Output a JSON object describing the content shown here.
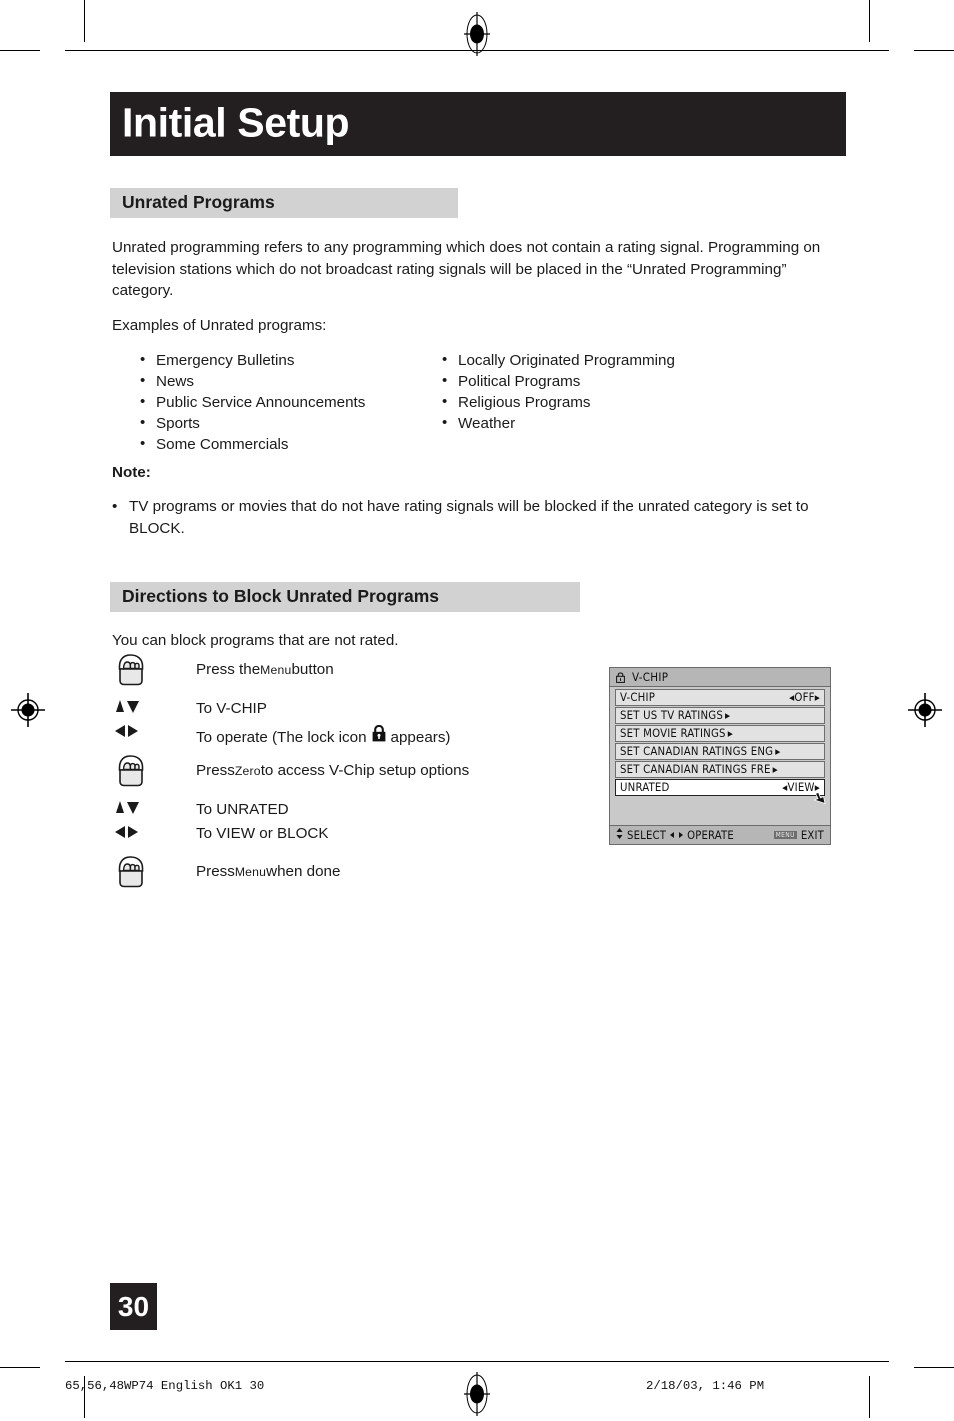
{
  "document": {
    "chapter_title": "Initial Setup",
    "page_number": "30"
  },
  "sections": {
    "unrated": {
      "heading": "Unrated Programs",
      "intro": "Unrated programming refers to any programming which does not contain a rating signal. Programming on television stations which do not broadcast rating signals will be placed in the “Unrated Programming” category.",
      "examples_label": "Examples of Unrated programs:",
      "examples_left": [
        "Emergency Bulletins",
        "News",
        "Public Service Announcements",
        "Sports",
        "Some Commercials"
      ],
      "examples_right": [
        "Locally Originated Programming",
        "Political Programs",
        "Religious Programs",
        "Weather"
      ],
      "note_label": "Note:",
      "note_text": "TV programs or movies that do not have rating signals will be blocked if the unrated category is set to BLOCK."
    },
    "directions": {
      "heading": "Directions to Block Unrated Programs",
      "intro": "You can block programs that are not rated.",
      "steps": [
        {
          "icon": "hand-press-button-icon",
          "text_pre": "Press the ",
          "smallcaps": "Menu",
          "text_post": " button"
        },
        {
          "icon": "up-down-arrows-icon",
          "text_pre": "To V-CHIP",
          "smallcaps": "",
          "text_post": ""
        },
        {
          "icon": "left-right-arrows-icon",
          "text_pre": "To operate (The lock icon ",
          "smallcaps": "",
          "text_post": " appears)"
        },
        {
          "icon": "hand-press-button-icon",
          "text_pre": "Press ",
          "smallcaps": "Zero",
          "text_post": " to access V-Chip setup options"
        },
        {
          "icon": "up-down-arrows-icon",
          "text_pre": "To UNRATED",
          "smallcaps": "",
          "text_post": ""
        },
        {
          "icon": "left-right-arrows-icon",
          "text_pre": "To VIEW or BLOCK",
          "smallcaps": "",
          "text_post": ""
        },
        {
          "icon": "hand-press-button-icon",
          "text_pre": "Press ",
          "smallcaps": "Menu",
          "text_post": " when done"
        }
      ]
    }
  },
  "osd": {
    "title": "V-CHIP",
    "title_icon": "lock-icon",
    "rows": [
      {
        "label": "V-CHIP",
        "value": "OFF",
        "type": "value",
        "highlight": false
      },
      {
        "label": "SET US TV RATINGS",
        "value": "",
        "type": "submenu",
        "highlight": false
      },
      {
        "label": "SET MOVIE RATINGS",
        "value": "",
        "type": "submenu",
        "highlight": false
      },
      {
        "label": "SET CANADIAN RATINGS ENG",
        "value": "",
        "type": "submenu",
        "highlight": false
      },
      {
        "label": "SET CANADIAN RATINGS FRE",
        "value": "",
        "type": "submenu",
        "highlight": false
      },
      {
        "label": "UNRATED",
        "value": "VIEW",
        "type": "value",
        "highlight": true
      }
    ],
    "footer": {
      "select_label": "SELECT",
      "operate_label": "OPERATE",
      "menu_chip": "MENU",
      "exit_label": "EXIT"
    }
  },
  "print_footer": {
    "left": "65,56,48WP74 English OK1  30",
    "right": "2/18/03, 1:46 PM"
  },
  "colors": {
    "banner_bg": "#231f20",
    "section_header_bg": "#d2d2d2",
    "osd_bg": "#c9c9c9",
    "osd_row_bg": "#e2e2e2",
    "osd_highlight_bg": "#ffffff",
    "text": "#1a1a1a"
  }
}
